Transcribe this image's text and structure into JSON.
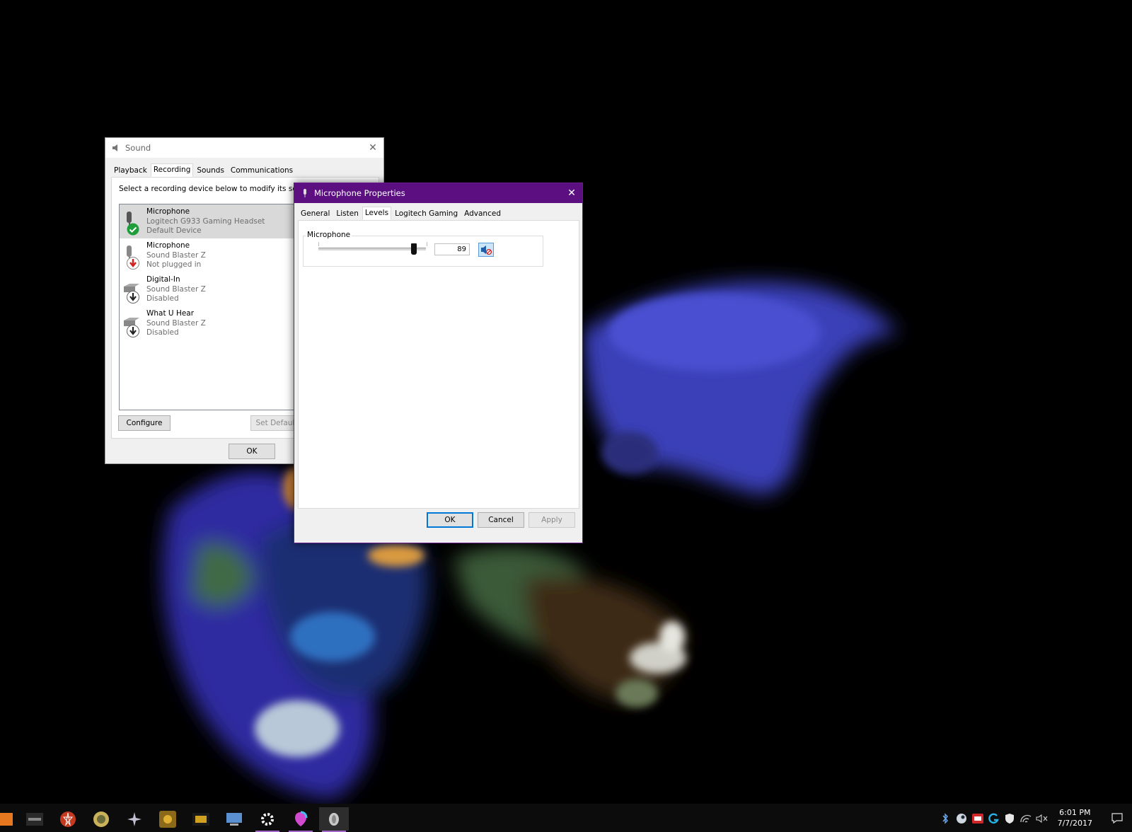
{
  "sound_window": {
    "title": "Sound",
    "tabs": [
      {
        "label": "Playback",
        "active": false
      },
      {
        "label": "Recording",
        "active": true
      },
      {
        "label": "Sounds",
        "active": false
      },
      {
        "label": "Communications",
        "active": false
      }
    ],
    "instruction": "Select a recording device below to modify its settings:",
    "devices": [
      {
        "name": "Microphone",
        "device": "Logitech G933 Gaming Headset",
        "status": "Default Device",
        "badge": "default",
        "selected": true,
        "icon": "microphone-icon"
      },
      {
        "name": "Microphone",
        "device": "Sound Blaster Z",
        "status": "Not plugged in",
        "badge": "unplugged",
        "selected": false,
        "icon": "microphone-icon"
      },
      {
        "name": "Digital-In",
        "device": "Sound Blaster Z",
        "status": "Disabled",
        "badge": "disabled",
        "selected": false,
        "icon": "line-in-icon"
      },
      {
        "name": "What U Hear",
        "device": "Sound Blaster Z",
        "status": "Disabled",
        "badge": "disabled",
        "selected": false,
        "icon": "line-in-icon"
      }
    ],
    "configure_label": "Configure",
    "set_default_label": "Set Default",
    "ok_label": "OK"
  },
  "mic_window": {
    "title": "Microphone Properties",
    "tabs": [
      {
        "label": "General",
        "active": false
      },
      {
        "label": "Listen",
        "active": false
      },
      {
        "label": "Levels",
        "active": true
      },
      {
        "label": "Logitech Gaming",
        "active": false
      },
      {
        "label": "Advanced",
        "active": false
      }
    ],
    "level_group_label": "Microphone",
    "level_value": "89",
    "level_fraction": 0.89,
    "ok_label": "OK",
    "cancel_label": "Cancel",
    "apply_label": "Apply"
  },
  "taskbar": {
    "clock_time": "6:01 PM",
    "clock_date": "7/7/2017"
  }
}
